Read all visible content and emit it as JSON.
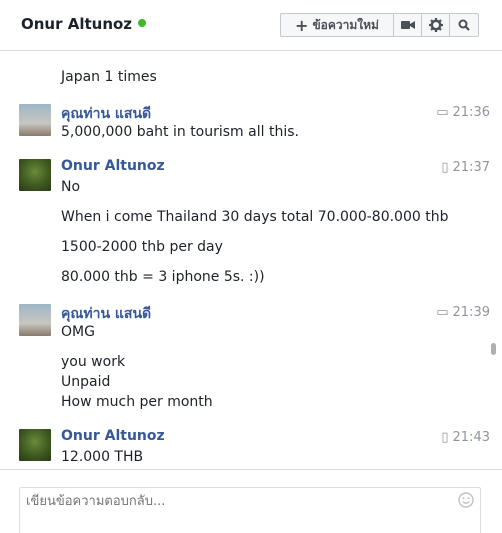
{
  "header": {
    "contact_name": "Onur Altunoz",
    "online_color": "#42b72a",
    "new_message_label": "ข้อความใหม่",
    "icons": [
      "plus-icon",
      "video-icon",
      "gear-icon",
      "search-icon"
    ]
  },
  "messages": [
    {
      "kind": "text",
      "text": "Japan 1 times"
    },
    {
      "kind": "sender",
      "name": "คุณท่าน แสนดี",
      "time": "21:36",
      "via": "web-chat-icon"
    },
    {
      "kind": "text",
      "text": "5,000,000 baht in tourism all this."
    },
    {
      "kind": "sender",
      "name": "Onur Altunoz",
      "time": "21:37",
      "via": "mobile-icon"
    },
    {
      "kind": "text",
      "text": "No"
    },
    {
      "kind": "text",
      "text": "When i come Thailand 30 days total 70.000-80.000 thb"
    },
    {
      "kind": "text",
      "text": "1500-2000 thb per day"
    },
    {
      "kind": "text",
      "text": "80.000 thb = 3 iphone 5s. :))"
    },
    {
      "kind": "sender",
      "name": "คุณท่าน แสนดี",
      "time": "21:39",
      "via": "web-chat-icon"
    },
    {
      "kind": "text",
      "text": "OMG"
    },
    {
      "kind": "text",
      "text": "you work"
    },
    {
      "kind": "text",
      "text": "Unpaid"
    },
    {
      "kind": "text",
      "text": "How much per month"
    },
    {
      "kind": "sender",
      "name": "Onur Altunoz",
      "time": "21:43",
      "via": "mobile-icon"
    },
    {
      "kind": "text",
      "text": "12.000 THB"
    }
  ],
  "compose": {
    "placeholder": "เขียนข้อความตอบกลับ...",
    "emoji_icon": "emoji-icon"
  }
}
